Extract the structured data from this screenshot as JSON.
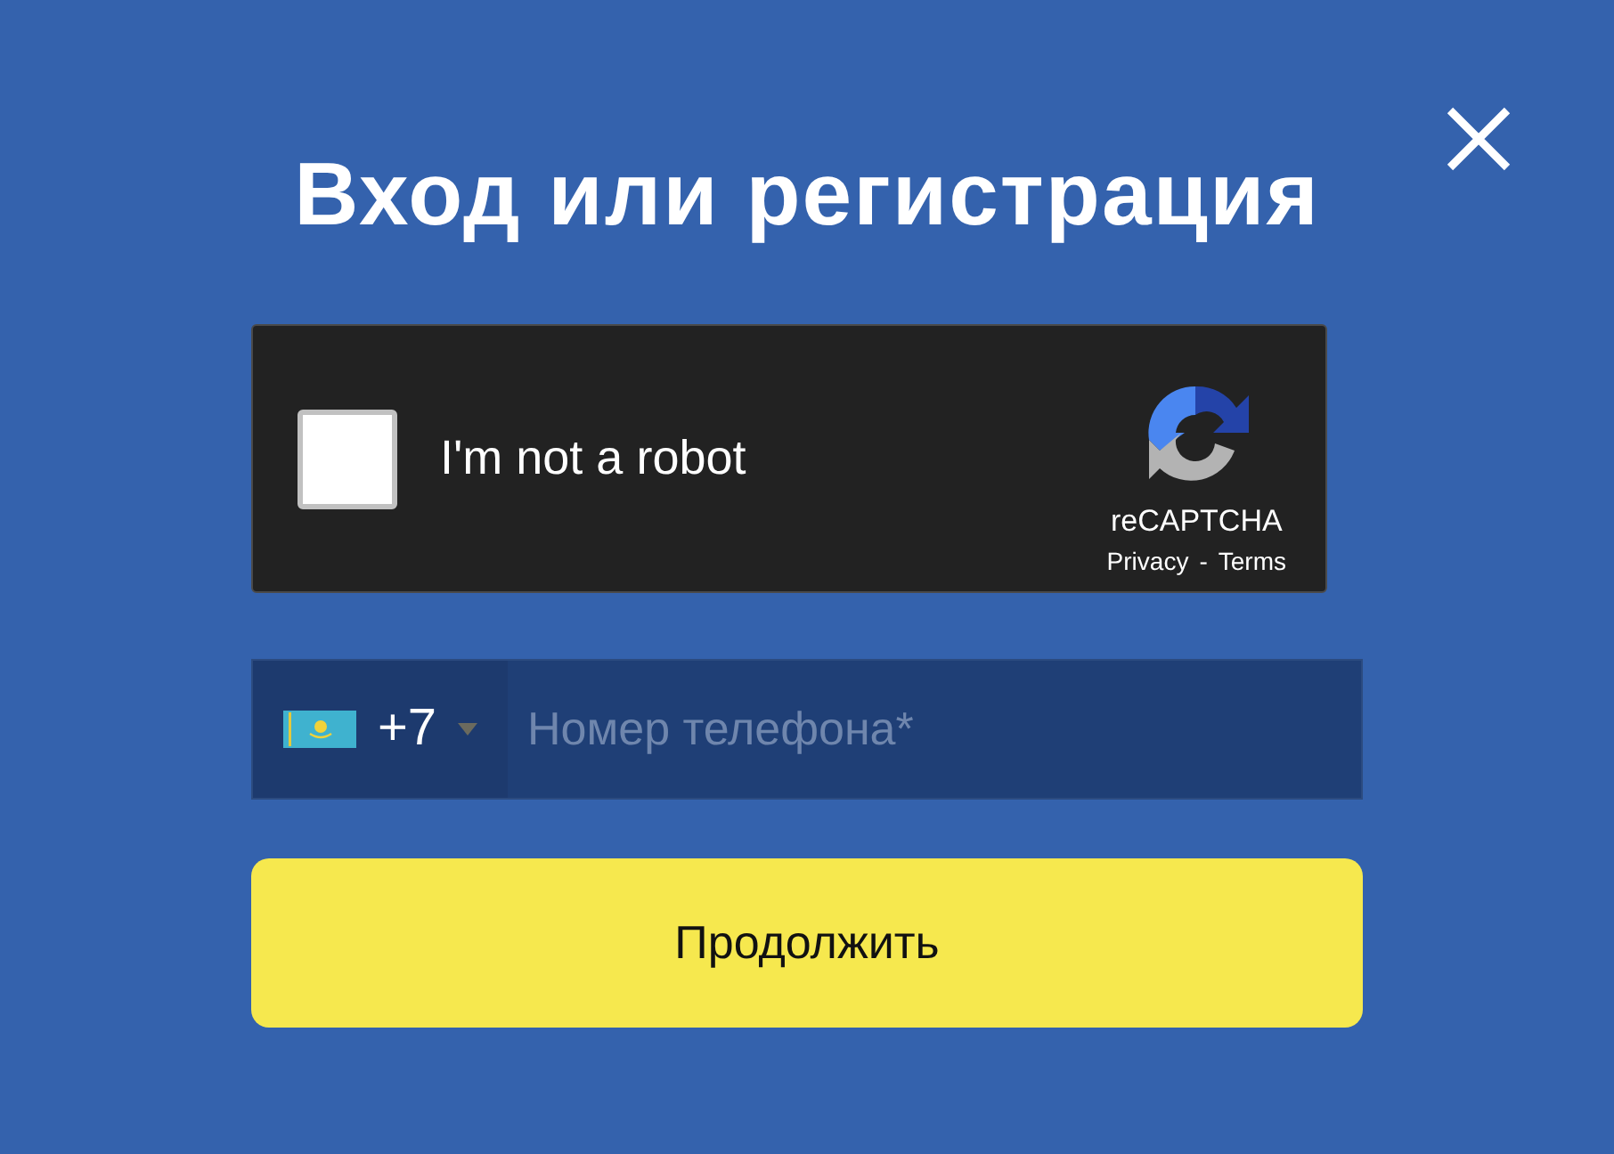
{
  "title": "Вход или регистрация",
  "captcha": {
    "label": "I'm not a robot",
    "checked": false,
    "brand": "reCAPTCHA",
    "links": [
      {
        "label": "Privacy"
      },
      {
        "label": "Terms"
      }
    ],
    "separator": "-"
  },
  "phone": {
    "country_code": "+7",
    "placeholder": "Номер телефона*"
  },
  "submit": {
    "label": "Продолжить"
  }
}
